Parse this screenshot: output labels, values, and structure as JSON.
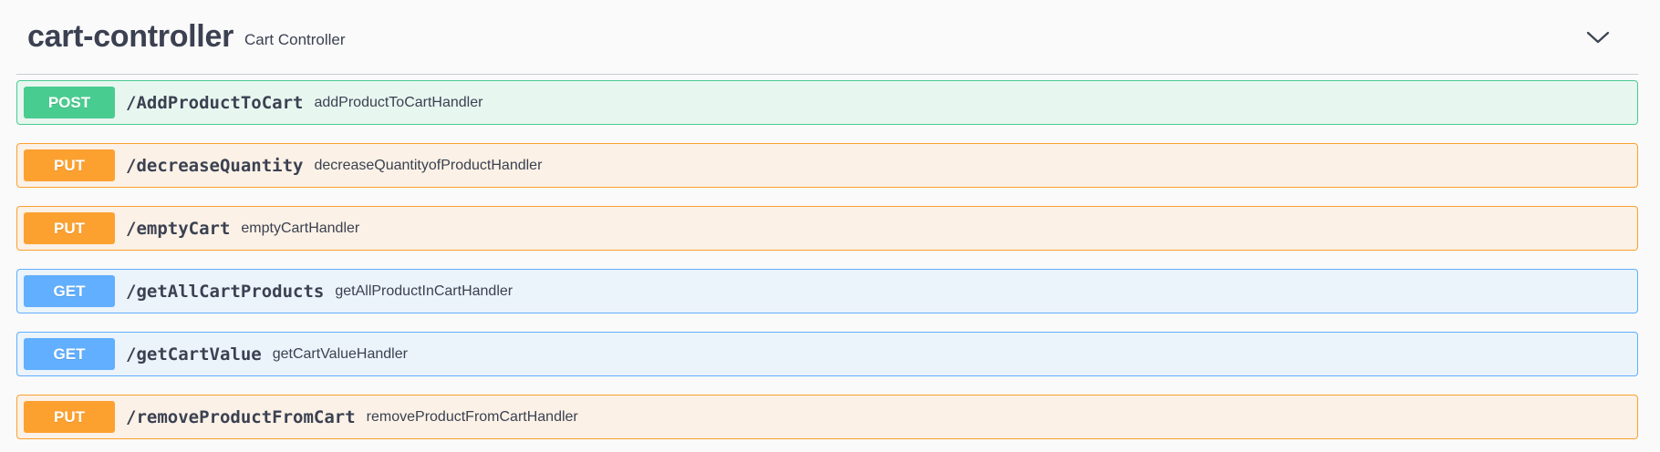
{
  "tag": {
    "name": "cart-controller",
    "description": "Cart Controller",
    "toggle_icon": "chevron-down-icon"
  },
  "colors": {
    "post": "#49cc90",
    "put": "#fca130",
    "get": "#61affe",
    "text": "#3b4151"
  },
  "operations": [
    {
      "method": "POST",
      "path": "/AddProductToCart",
      "summary": "addProductToCartHandler"
    },
    {
      "method": "PUT",
      "path": "/decreaseQuantity",
      "summary": "decreaseQuantityofProductHandler"
    },
    {
      "method": "PUT",
      "path": "/emptyCart",
      "summary": "emptyCartHandler"
    },
    {
      "method": "GET",
      "path": "/getAllCartProducts",
      "summary": "getAllProductInCartHandler"
    },
    {
      "method": "GET",
      "path": "/getCartValue",
      "summary": "getCartValueHandler"
    },
    {
      "method": "PUT",
      "path": "/removeProductFromCart",
      "summary": "removeProductFromCartHandler"
    }
  ]
}
